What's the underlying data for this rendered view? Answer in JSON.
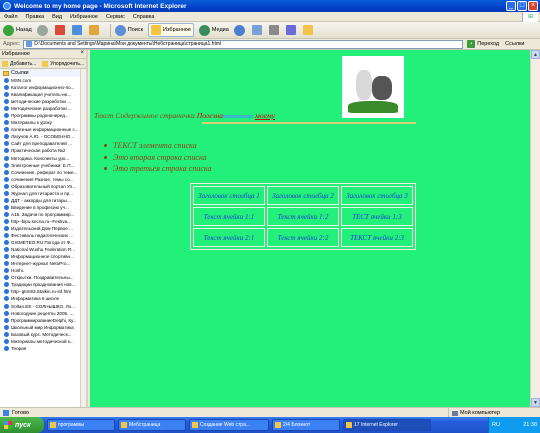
{
  "window": {
    "title": "Welcome to my home page - Microsoft Internet Explorer",
    "buttons": [
      "_",
      "□",
      "×"
    ]
  },
  "menubar": [
    "Файл",
    "Правка",
    "Вид",
    "Избранное",
    "Сервис",
    "Справка"
  ],
  "toolbar": {
    "back_label": "Назад",
    "search_label": "Поиск",
    "favorites_label": "Избранное",
    "media_label": "Медиа"
  },
  "addressbar": {
    "label": "Адрес:",
    "value": "D:\\Documents and Settings\\Марина\\Мои документы\\Небстраница\\страница1.html",
    "go_label": "Переход",
    "links_label": "Ссылки"
  },
  "sidebar": {
    "title": "Избранное",
    "add_label": "Добавить...",
    "organize_label": "Упорядочить...",
    "folder_label": "Ссылки",
    "items": [
      "MSN.com",
      "Каталог информационно-по...",
      "Квалификация учитель-ин...",
      "методические разработки ...",
      "Методические разработки ...",
      "Программы родоначеред...",
      "Материалы к уроку",
      "полезные информационные с...",
      "Лагунов А.Ю. - ОСОБЕННО...",
      "Сайт для преподавателей ...",
      "Практическая работа №2",
      "Методика. Конспекты уро...",
      "Электронные учебники: Е.П...",
      "Сочинение, реферат по теме...",
      "сочинения Разное, темы со...",
      "Образовательный портал Ул...",
      "Журнал для гитариста и пр...",
      "ДДТ - аккорды для гитары ...",
      "Введение в професию уч...",
      "A15. Задачи по программир...",
      "http--bipu.secna.ru--Festiva...",
      "Издательский Дом Первое ...",
      "Фестиваль педагогических ...",
      "GISMETEO.RU Погода от Ф...",
      "National Wushu Federation R...",
      "Информационное спортивн...",
      "Интернет-журнал NetoPro...",
      "Hoshi.",
      "Открытки. Поздравительны...",
      "Традиции празднования нов...",
      "http--gtim93.Stalkin.ru-inf.htm",
      "Информатика в школе",
      "Soltan.EE - СОЛНЫШКО. Ло...",
      "Новогодние рецепты 2005. ...",
      "ПрограммированиеDelphi, Ку...",
      "Школьный мир Информатика",
      "Базовый курс. Методическ...",
      "Материалы методической к...",
      "Теория"
    ]
  },
  "page": {
    "intro_text": "Текст Содержимое странички ",
    "intro_red": "Полезна",
    "intro_link": "моему",
    "list_items": [
      "ТЕКСТ элемента списка",
      "Это вторая строка списка",
      "Это третьея строка списка"
    ],
    "table": [
      [
        "Заголовок столбца 1",
        "Заголовок столбца 2",
        "Заголовок столбца 3"
      ],
      [
        "Текст ячейки 1:1",
        "Текст ячейки 1:2",
        "ТЕСТ ячейки 1:3"
      ],
      [
        "Текст ячейки 2:1",
        "Текст ячейки 2:2",
        "ТЕКСТ ячейки 2:3"
      ]
    ]
  },
  "statusbar": {
    "status": "Готово",
    "zone": "Мой компьютер"
  },
  "taskbar": {
    "start_label": "пуск",
    "tasks": [
      "программы",
      "Мебстраница",
      "Создание Web стра...",
      "2/4 Блокнот",
      "17 Internet Explorer"
    ],
    "lang": "RU",
    "clock": "21:38"
  },
  "colors": {
    "page_background": "#23f07a",
    "text_brown": "#8b4513",
    "table_text": "#1a3fd6",
    "title_blue": "#0042c8"
  }
}
